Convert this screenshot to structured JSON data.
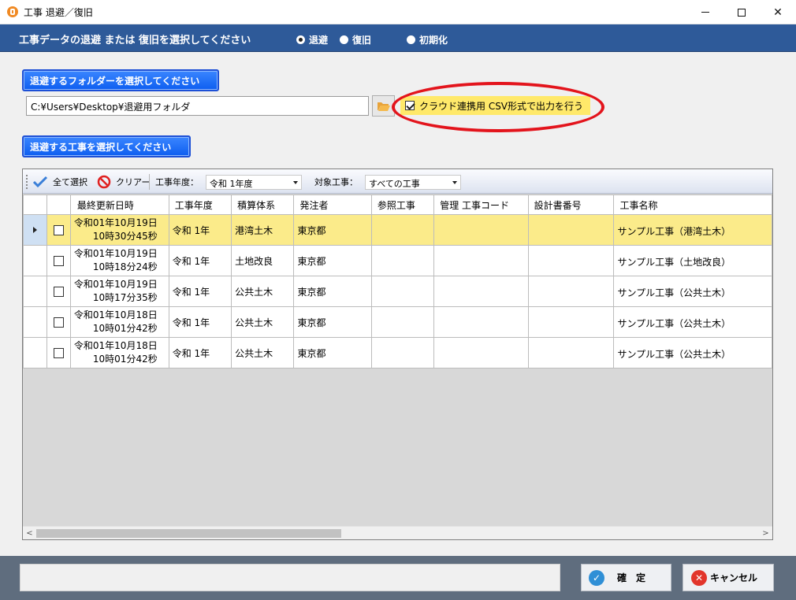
{
  "window": {
    "title": "工事 退避／復旧",
    "min_glyph": "—",
    "max_glyph": "☐",
    "close_glyph": "✕"
  },
  "header": {
    "title": "工事データの退避 または 復旧を選択してください",
    "radios": [
      {
        "label": "退避",
        "selected": true
      },
      {
        "label": "復旧",
        "selected": false
      },
      {
        "label": "初期化",
        "selected": false
      }
    ]
  },
  "folder_section": {
    "button_label": "退避するフォルダーを選択してください",
    "path_value": "C:¥Users¥Desktop¥退避用フォルダ",
    "csv_option": {
      "label": "クラウド連携用 CSV形式で出力を行う",
      "checked": true
    }
  },
  "project_section": {
    "button_label": "退避する工事を選択してください"
  },
  "toolbar": {
    "select_all_label": "全て選択",
    "clear_label": "クリアー",
    "year_label": "工事年度：",
    "year_value": "令和 1年度",
    "target_label": "対象工事：",
    "target_value": "すべての工事"
  },
  "table": {
    "columns": [
      "最終更新日時",
      "工事年度",
      "積算体系",
      "発注者",
      "参照工事",
      "管理 工事コード",
      "設計書番号",
      "工事名称"
    ],
    "rows": [
      {
        "date": "令和01年10月19日",
        "time": "10時30分45秒",
        "year": "令和 1年",
        "system": "港湾土木",
        "client": "東京都",
        "ref": "",
        "code": "",
        "design_no": "",
        "name": "サンプル工事（港湾土木）",
        "selected": true,
        "checked": false
      },
      {
        "date": "令和01年10月19日",
        "time": "10時18分24秒",
        "year": "令和 1年",
        "system": "土地改良",
        "client": "東京都",
        "ref": "",
        "code": "",
        "design_no": "",
        "name": "サンプル工事（土地改良）",
        "selected": false,
        "checked": false
      },
      {
        "date": "令和01年10月19日",
        "time": "10時17分35秒",
        "year": "令和 1年",
        "system": "公共土木",
        "client": "東京都",
        "ref": "",
        "code": "",
        "design_no": "",
        "name": "サンプル工事（公共土木）",
        "selected": false,
        "checked": false
      },
      {
        "date": "令和01年10月18日",
        "time": "10時01分42秒",
        "year": "令和 1年",
        "system": "公共土木",
        "client": "東京都",
        "ref": "",
        "code": "",
        "design_no": "",
        "name": "サンプル工事（公共土木）",
        "selected": false,
        "checked": false
      },
      {
        "date": "令和01年10月18日",
        "time": "10時01分42秒",
        "year": "令和 1年",
        "system": "公共土木",
        "client": "東京都",
        "ref": "",
        "code": "",
        "design_no": "",
        "name": "サンプル工事（公共土木）",
        "selected": false,
        "checked": false
      }
    ]
  },
  "footer": {
    "status_text": "",
    "ok_label": "確　定",
    "cancel_label": "キャンセル"
  },
  "colors": {
    "header_band": "#2e5a99",
    "section_button": "#0d5ef0",
    "csv_highlight": "#ffe96a",
    "annotation_ellipse": "#e3141c",
    "selected_row": "#fbeb8a",
    "footer": "#5f6d7e"
  },
  "icons": {
    "app": "app-logo-icon",
    "folder": "folder-open-icon",
    "select_all": "checkmark-icon",
    "clear": "prohibited-icon",
    "ok": "check-circle-icon",
    "cancel": "x-circle-icon"
  }
}
